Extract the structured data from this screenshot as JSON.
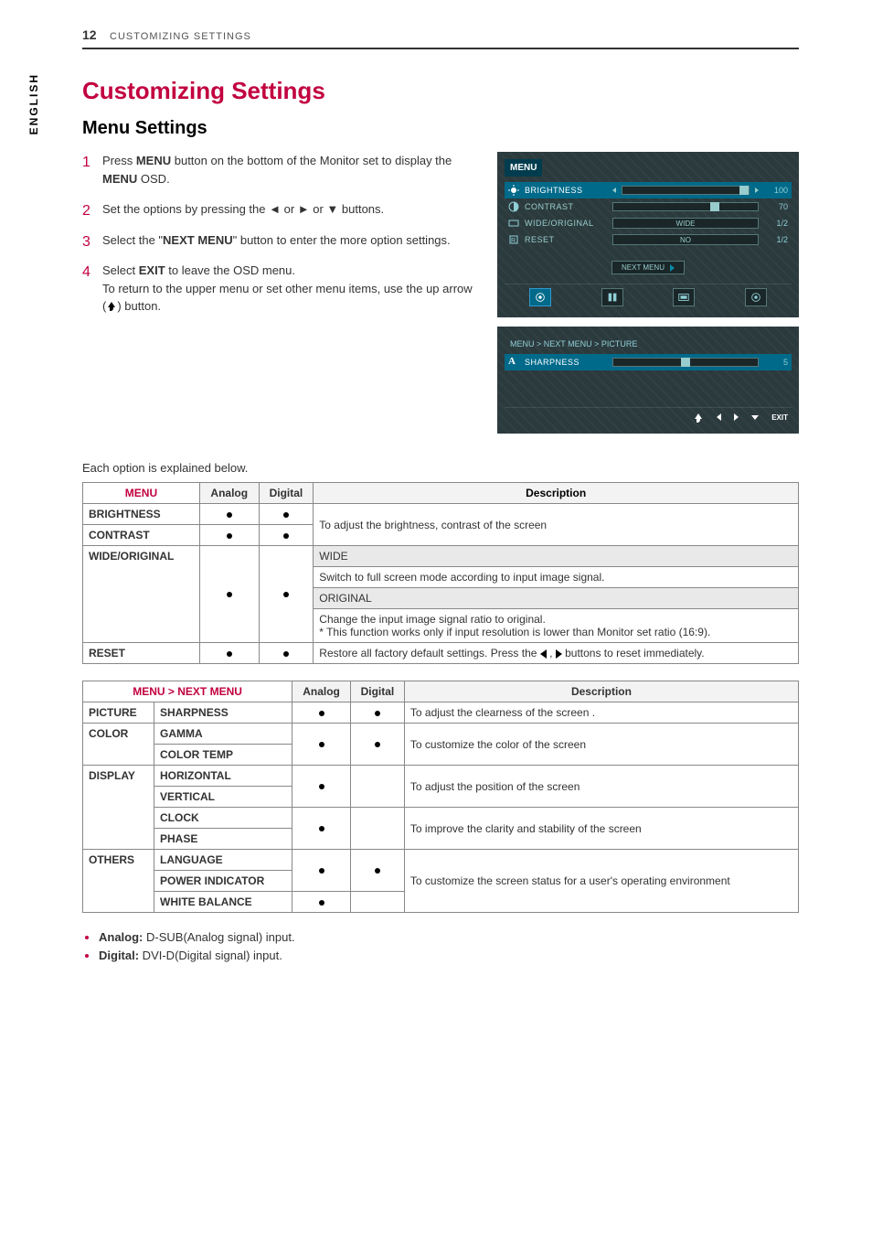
{
  "header": {
    "page_number": "12",
    "section": "CUSTOMIZING SETTINGS"
  },
  "side_tab": "ENGLISH",
  "title": "Customizing Settings",
  "subtitle": "Menu Settings",
  "steps": [
    {
      "n": "1",
      "pre": "Press ",
      "bold1": "MENU",
      "mid": " button on the bottom of the Monitor set to display the ",
      "bold2": "MENU",
      "post": " OSD."
    },
    {
      "n": "2",
      "text": "Set the options by pressing the ◄ or ► or ▼ buttons."
    },
    {
      "n": "3",
      "pre": "Select the \"",
      "bold1": "NEXT MENU",
      "post": "\" button to enter the more option settings."
    },
    {
      "n": "4",
      "pre": "Select ",
      "bold1": "EXIT",
      "mid": " to leave the OSD menu.",
      "extra": "To return to the upper menu or set other menu items, use the up arrow (",
      "extra_post": ") button."
    }
  ],
  "note_after": "Each option is explained below.",
  "osd1": {
    "title": "MENU",
    "rows": [
      {
        "icon": "brightness-icon",
        "label": "BRIGHTNESS",
        "type": "slider",
        "value": "100",
        "thumbPct": 100,
        "hl": true
      },
      {
        "icon": "contrast-icon",
        "label": "CONTRAST",
        "type": "slider",
        "value": "70",
        "thumbPct": 70
      },
      {
        "icon": "aspect-icon",
        "label": "WIDE/ORIGINAL",
        "type": "button",
        "btn": "WIDE",
        "value": "1/2"
      },
      {
        "icon": "reset-icon",
        "label": "RESET",
        "type": "button",
        "btn": "NO",
        "value": "1/2"
      }
    ],
    "next_label": "NEXT MENU"
  },
  "osd2": {
    "breadcrumb": "MENU  >  NEXT MENU  >  PICTURE",
    "row": {
      "icon": "sharpness-icon",
      "label": "SHARPNESS",
      "value": "5",
      "thumbPct": 50
    },
    "footer": {
      "exit": "EXIT"
    }
  },
  "table1": {
    "headers": {
      "menu": "MENU",
      "analog": "Analog",
      "digital": "Digital",
      "desc": "Description"
    },
    "rows": {
      "brightness": "BRIGHTNESS",
      "contrast": "CONTRAST",
      "wideorig": "WIDE/ORIGINAL",
      "reset": "RESET"
    },
    "desc": {
      "bc": "To adjust the brightness, contrast of the screen",
      "wide_h": "WIDE",
      "wide_t": "Switch to full screen mode according to input image signal.",
      "orig_h": "ORIGINAL",
      "orig_t": "Change the input image signal ratio to original.\n* This function works only if input resolution is lower than Monitor set ratio (16:9).",
      "reset_pre": "Restore all factory default settings. Press the ",
      "reset_post": "  buttons to reset immediately."
    }
  },
  "table2": {
    "headers": {
      "menu": "MENU > NEXT MENU",
      "analog": "Analog",
      "digital": "Digital",
      "desc": "Description"
    },
    "groups": {
      "picture": {
        "name": "PICTURE",
        "items": {
          "sharpness": "SHARPNESS"
        },
        "desc": "To adjust the clearness of the screen ."
      },
      "color": {
        "name": "COLOR",
        "items": {
          "gamma": "GAMMA",
          "colortemp": "COLOR TEMP"
        },
        "desc": "To customize the color of the screen"
      },
      "display": {
        "name": "DISPLAY",
        "items": {
          "horizontal": "HORIZONTAL",
          "vertical": "VERTICAL",
          "clock": "CLOCK",
          "phase": "PHASE"
        },
        "desc_pos": "To adjust the position of the screen",
        "desc_clk": "To improve the clarity and stability of the screen"
      },
      "others": {
        "name": "OTHERS",
        "items": {
          "language": "LANGUAGE",
          "powerind": "POWER INDICATOR",
          "whitebal": "WHITE BALANCE"
        },
        "desc": "To customize the screen status for a user's operating environment"
      }
    }
  },
  "notes": {
    "analog_lbl": "Analog:",
    "analog_txt": " D-SUB(Analog signal) input.",
    "digital_lbl": "Digital:",
    "digital_txt": " DVI-D(Digital signal) input."
  }
}
